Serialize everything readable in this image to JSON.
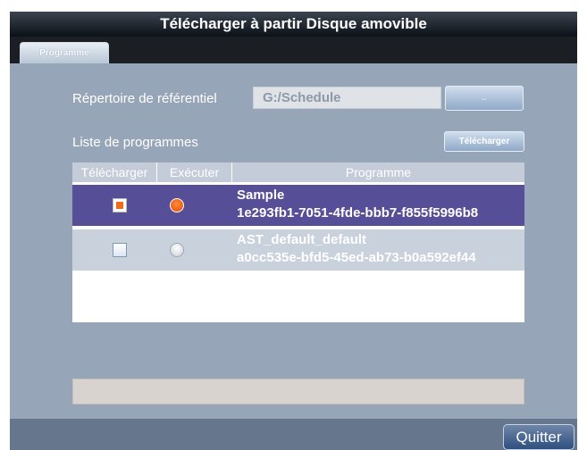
{
  "window": {
    "title": "Télécharger  à partir Disque amovible"
  },
  "tabs": [
    {
      "label": "Programme",
      "active": true
    }
  ],
  "repository": {
    "label": "Répertoire de référentiel",
    "path_value": "G:/Schedule",
    "browse_label": ".."
  },
  "program_list": {
    "label": "Liste de programmes",
    "download_button": "Télécharger",
    "columns": [
      "Télécharger",
      "Exécuter",
      "Programme"
    ],
    "rows": [
      {
        "download_checked": true,
        "execute_selected": true,
        "name": "Sample",
        "id": "1e293fb1-7051-4fde-bbb7-f855f5996b8",
        "selected": true
      },
      {
        "download_checked": false,
        "execute_selected": false,
        "name": "AST_default_default",
        "id": "a0cc535e-bfd5-45ed-ab73-b0a592ef44",
        "selected": false
      }
    ]
  },
  "footer": {
    "quit_label": "Quitter"
  },
  "colors": {
    "accent_selected_row": "#574e98",
    "checkbox_check": "#ef6a19",
    "panel_background": "#96a5b8"
  }
}
